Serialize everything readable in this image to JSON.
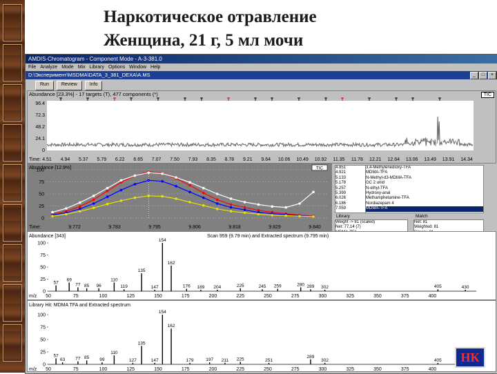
{
  "slide": {
    "title_line1": "Наркотическое отравление",
    "title_line2": "Женщина, 21 г, 5 мл мочи",
    "badge": "НК"
  },
  "window": {
    "title": "AMDIS-Chromatogram - Component Mode - A-3-381.0",
    "menu": [
      "File",
      "Analyze",
      "Mode",
      "Mix",
      "Library",
      "Options",
      "Window",
      "Help"
    ],
    "file_title": "D:\\Эксперимент\\MSDMA\\DATA_3_381_DEXA\\A.MS",
    "toolbar": [
      "Run",
      "Review",
      "Info"
    ]
  },
  "tic_panel": {
    "header": "Abundance [23.3%] - 17 targets (T), 477 components (*)",
    "tag": "TIC",
    "y_ticks": [
      "96.4",
      "72.3",
      "48.2",
      "24.1",
      "0"
    ],
    "time_label": "Time:",
    "times": [
      "4.51",
      "4.94",
      "5.37",
      "5.79",
      "6.22",
      "6.65",
      "7.07",
      "7.50",
      "7.93",
      "8.35",
      "8.78",
      "9.21",
      "9.64",
      "10.06",
      "10.49",
      "10.92",
      "11.35",
      "11.78",
      "12.21",
      "12.64",
      "13.06",
      "13.49",
      "13.91",
      "14.34"
    ]
  },
  "ion_panel": {
    "header": "Abundance [12.9%]",
    "tag": "TIC",
    "y_ticks": [
      "100",
      "75",
      "50",
      "25",
      "0"
    ],
    "time_label": "Time:",
    "times": [
      "9.772",
      "9.783",
      "9.795",
      "9.806",
      "9.818",
      "9.829",
      "9.840"
    ],
    "series_tags": [
      "154",
      "162",
      "135",
      "110"
    ],
    "series": [
      {
        "name": "154",
        "color": "#ff0000",
        "values": [
          8,
          14,
          24,
          38,
          56,
          74,
          88,
          96,
          93,
          82,
          68,
          52,
          38,
          28,
          22,
          16,
          12,
          9,
          6,
          4
        ]
      },
      {
        "name": "162",
        "color": "#0000ff",
        "values": [
          6,
          11,
          19,
          30,
          44,
          58,
          70,
          78,
          76,
          66,
          54,
          42,
          30,
          22,
          17,
          12,
          9,
          7,
          5,
          3
        ]
      },
      {
        "name": "135",
        "color": "#e6e600",
        "values": [
          4,
          8,
          14,
          21,
          29,
          36,
          42,
          46,
          45,
          40,
          33,
          26,
          19,
          14,
          11,
          8,
          6,
          5,
          4,
          3
        ]
      },
      {
        "name": "110",
        "color": "#ffffff",
        "values": [
          12,
          20,
          32,
          46,
          62,
          78,
          88,
          94,
          92,
          84,
          74,
          62,
          50,
          40,
          33,
          28,
          24,
          22,
          30,
          54
        ]
      }
    ],
    "list_left": [
      "4.851",
      "4.921",
      "5.133",
      "5.178",
      "5.257",
      "5.399",
      "6.026",
      "6.186",
      "7.059"
    ],
    "list_right": [
      "3,4-Methylenedioxy-TFA",
      "MDMA-TFA",
      "N-Methyl-d3-MDMA-TFA",
      "GC 2 unid",
      "N-ethyl-TFA",
      "Hydroxy-anal",
      "Methamphetamine-TFA",
      "Nordiazepam 4",
      "MDMA-TFA"
    ],
    "selected_right_index": 8,
    "library_label": "Library",
    "match_label": "Match",
    "library_items": [
      "Weight -> 81 (scaled)",
      "Net: 77.14 (7)",
      "MDMA-TFA",
      "MDEA-TFA"
    ],
    "match_items": [
      "Net: 81",
      "Weighted: 81",
      "Simple: 81",
      "Probability: 71"
    ]
  },
  "spectrum1": {
    "header": "Abundance [343]",
    "caption": "Scan 959 (9.79 min) and Extracted spectrum (9.795 min)",
    "y_ticks": [
      "100",
      "75",
      "50",
      "25",
      "0"
    ],
    "x_label": "m/z",
    "x_ticks": [
      "50",
      "75",
      "100",
      "125",
      "150",
      "175",
      "200",
      "225",
      "250",
      "275",
      "300",
      "325",
      "350",
      "375",
      "400"
    ],
    "peaks": [
      [
        57,
        12,
        "57"
      ],
      [
        69,
        18,
        "69"
      ],
      [
        77,
        8,
        "77"
      ],
      [
        85,
        6,
        "85"
      ],
      [
        96,
        6,
        "96"
      ],
      [
        110,
        18,
        "110"
      ],
      [
        119,
        4,
        "119"
      ],
      [
        135,
        37,
        "135"
      ],
      [
        147,
        3,
        "147"
      ],
      [
        154,
        100,
        "154"
      ],
      [
        162,
        53,
        "162"
      ],
      [
        176,
        5,
        "176"
      ],
      [
        189,
        3,
        "189"
      ],
      [
        204,
        3,
        "204"
      ],
      [
        225,
        6,
        "225"
      ],
      [
        245,
        4,
        "245"
      ],
      [
        259,
        5,
        "259"
      ],
      [
        280,
        8,
        "280"
      ],
      [
        289,
        4,
        "289"
      ],
      [
        302,
        3,
        "302"
      ],
      [
        405,
        4,
        "405"
      ],
      [
        430,
        3,
        "430"
      ]
    ]
  },
  "spectrum2": {
    "header": "Library Hit: MDMA TFA and Extracted spectrum",
    "y_ticks": [
      "100",
      "75",
      "50",
      "25",
      "0"
    ],
    "x_label": "m/z",
    "x_ticks": [
      "50",
      "75",
      "100",
      "125",
      "150",
      "175",
      "200",
      "225",
      "250",
      "275",
      "300",
      "325",
      "350",
      "375",
      "400"
    ],
    "peaks": [
      [
        57,
        12,
        "57"
      ],
      [
        63,
        4,
        "63"
      ],
      [
        77,
        6,
        "77"
      ],
      [
        85,
        8,
        "85"
      ],
      [
        99,
        4,
        "99"
      ],
      [
        110,
        18,
        "110"
      ],
      [
        127,
        3,
        "127"
      ],
      [
        135,
        37,
        "135"
      ],
      [
        147,
        3,
        "147"
      ],
      [
        154,
        100,
        "154"
      ],
      [
        162,
        72,
        "162"
      ],
      [
        179,
        3,
        "179"
      ],
      [
        197,
        4,
        "197"
      ],
      [
        211,
        3,
        "211"
      ],
      [
        225,
        5,
        "225"
      ],
      [
        251,
        3,
        "251"
      ],
      [
        289,
        10,
        "289"
      ],
      [
        302,
        3,
        "302"
      ],
      [
        405,
        3,
        "405"
      ]
    ]
  },
  "colors": {
    "accent": "#0a246a",
    "plot_bg": "#ffffff",
    "tic_bg": "#808080",
    "badge_bg": "#0e2a8f",
    "badge_text": "#ff2a2a"
  }
}
